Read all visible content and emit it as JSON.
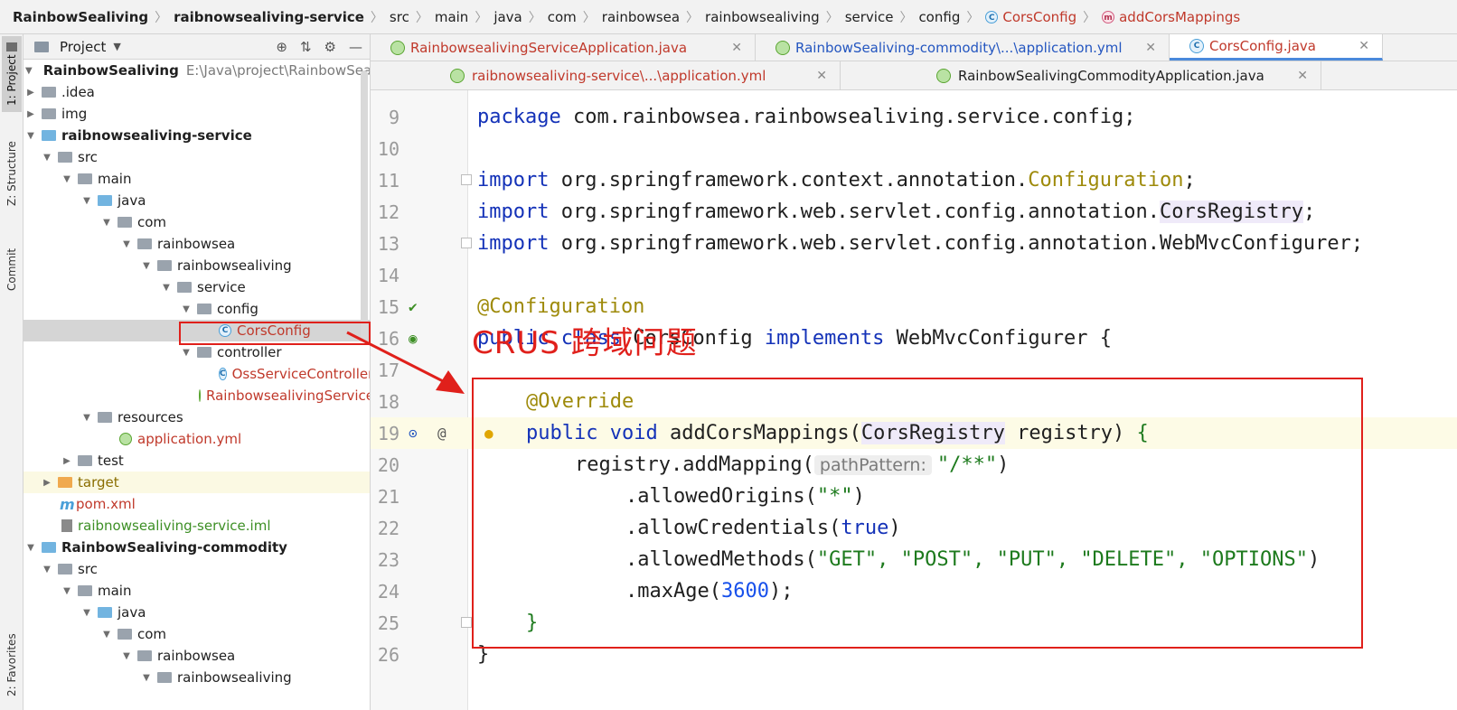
{
  "breadcrumb": {
    "items": [
      "RainbowSealiving",
      "raibnowsealiving-service",
      "src",
      "main",
      "java",
      "com",
      "rainbowsea",
      "rainbowsealiving",
      "service",
      "config",
      "CorsConfig",
      "addCorsMappings"
    ]
  },
  "toolstrip": {
    "project_tab": "1: Project",
    "structure_tab": "Z: Structure",
    "commit_tab": "Commit",
    "favorites_tab": "2: Favorites"
  },
  "project_panel": {
    "title": "Project",
    "root_name": "RainbowSealiving",
    "root_path": "E:\\Java\\project\\RainbowSealiving",
    "items": [
      ".idea",
      "img",
      "raibnowsealiving-service",
      "src",
      "main",
      "java",
      "com",
      "rainbowsea",
      "rainbowsealiving",
      "service",
      "config",
      "CorsConfig",
      "controller",
      "OssServiceController",
      "RainbowsealivingServiceApplication",
      "resources",
      "application.yml",
      "test",
      "target",
      "pom.xml",
      "raibnowsealiving-service.iml",
      "RainbowSealiving-commodity",
      "src",
      "main",
      "java",
      "com",
      "rainbowsea",
      "rainbowsealiving"
    ]
  },
  "tabs": {
    "row1": [
      {
        "label": "RainbowsealivingServiceApplication.java"
      },
      {
        "label": "RainbowSealiving-commodity\\...\\application.yml"
      },
      {
        "label": "CorsConfig.java"
      }
    ],
    "row2": [
      {
        "label": "raibnowsealiving-service\\...\\application.yml"
      },
      {
        "label": "RainbowSealivingCommodityApplication.java"
      }
    ]
  },
  "editor": {
    "line_numbers": [
      "9",
      "10",
      "11",
      "12",
      "13",
      "14",
      "15",
      "16",
      "17",
      "18",
      "19",
      "20",
      "21",
      "22",
      "23",
      "24",
      "25",
      "26"
    ],
    "package_kw": "package",
    "package_name": " com.rainbowsea.rainbowsealiving.service.config;",
    "import_kw": "import",
    "import1_pkg": " org.springframework.context.annotation.",
    "import1_cls": "Configuration",
    "import2_pkg": " org.springframework.web.servlet.config.annotation.",
    "import2_cls": "CorsRegistry",
    "import3": " org.springframework.web.servlet.config.annotation.WebMvcConfigurer;",
    "semicolon": ";",
    "annotation_config": "@Configuration",
    "class_public": "public",
    "class_class": " class",
    "class_name": " CorsConfig ",
    "class_implements": "implements",
    "class_iface": " WebMvcConfigurer ",
    "open_brace": "{",
    "override": "@Override",
    "method_public": "public",
    "method_void": " void",
    "method_name": " addCorsMappings(",
    "method_param_type": "CorsRegistry",
    "method_param_name": " registry) ",
    "line20_pre": "registry.addMapping(",
    "line20_hint": "pathPattern:",
    "line20_str": "\"/**\"",
    "line20_end": ")",
    "line21_pre": ".allowedOrigins(",
    "line21_str": "\"*\"",
    "line21_end": ")",
    "line22_pre": ".allowCredentials(",
    "line22_val": "true",
    "line22_end": ")",
    "line23_pre": ".allowedMethods(",
    "line23_args": "\"GET\", \"POST\", \"PUT\", \"DELETE\", \"OPTIONS\"",
    "line23_end": ")",
    "line24_pre": ".maxAge(",
    "line24_val": "3600",
    "line24_end": ");",
    "close_brace_inner": "}",
    "close_brace_outer": "}"
  },
  "annotation": {
    "label": "CRUS 跨域问题",
    "color": "#e0201b"
  },
  "colors": {
    "keyword": "#1432b8",
    "annotation": "#9e8a0a",
    "string": "#1d7a1d",
    "number": "#1750eb",
    "active_tab_underline": "#4a89dc"
  }
}
